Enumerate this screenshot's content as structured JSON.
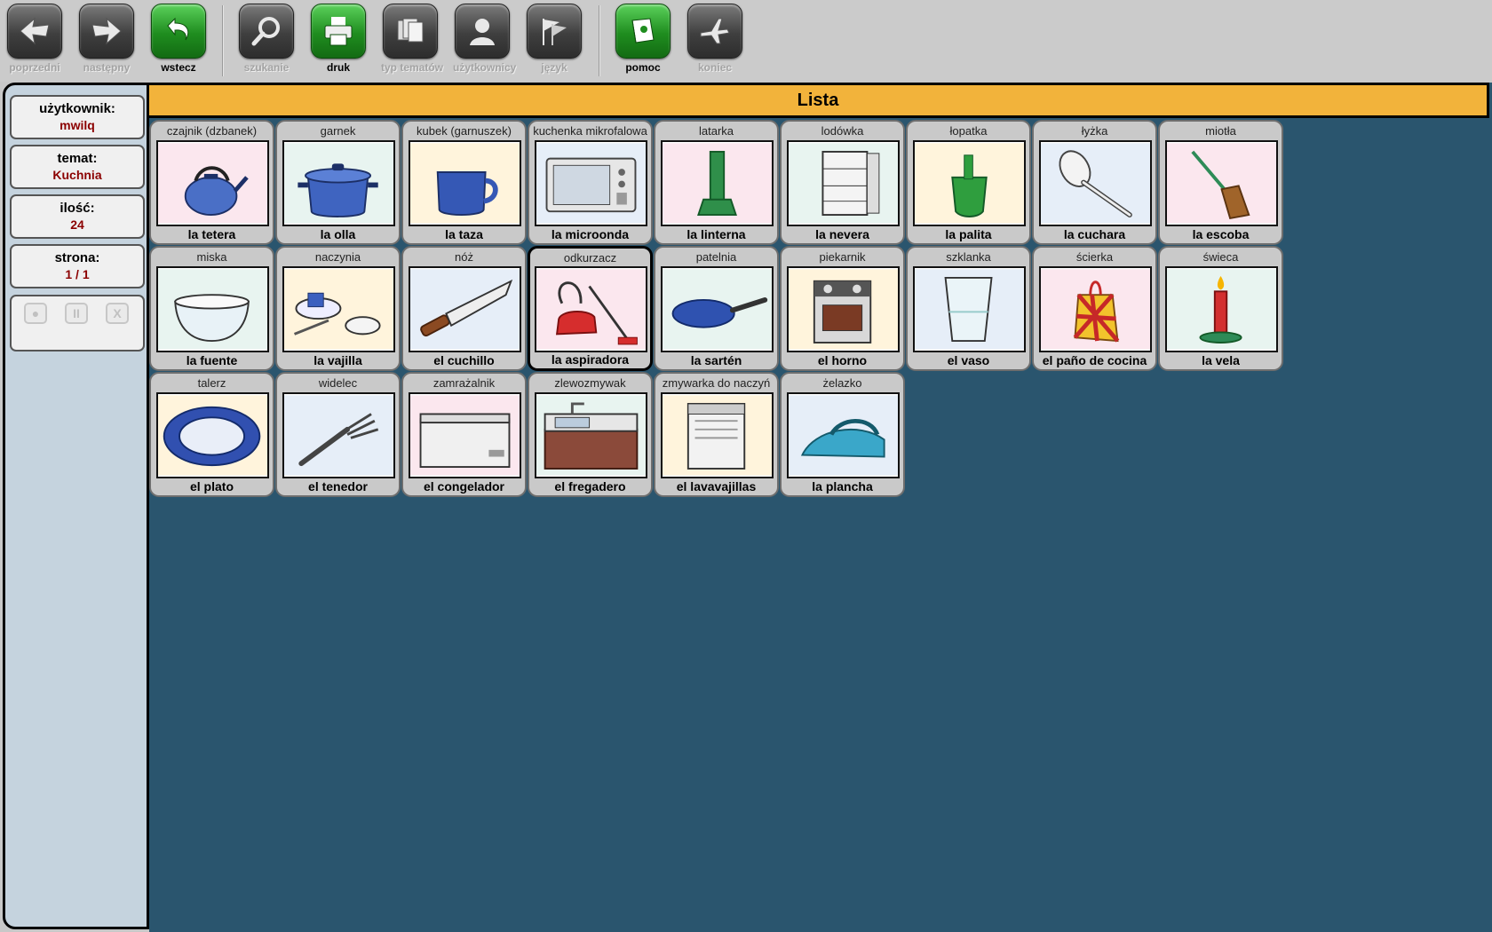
{
  "toolbar": {
    "buttons": [
      {
        "label": "poprzedni",
        "icon": "arrow-left-icon",
        "state": "disabled"
      },
      {
        "label": "następny",
        "icon": "arrow-right-icon",
        "state": "disabled"
      },
      {
        "label": "wstecz",
        "icon": "undo-icon",
        "state": "active"
      },
      {
        "label": "szukanie",
        "icon": "magnifier-icon",
        "state": "disabled"
      },
      {
        "label": "druk",
        "icon": "print-icon",
        "state": "active"
      },
      {
        "label": "typ tematów",
        "icon": "cards-icon",
        "state": "disabled"
      },
      {
        "label": "użytkownicy",
        "icon": "user-icon",
        "state": "disabled"
      },
      {
        "label": "język",
        "icon": "flags-icon",
        "state": "disabled"
      },
      {
        "label": "pomoc",
        "icon": "help-book-icon",
        "state": "active"
      },
      {
        "label": "koniec",
        "icon": "exit-plane-icon",
        "state": "disabled"
      }
    ]
  },
  "sidebar": {
    "user_label": "użytkownik:",
    "user_value": "mwilq",
    "topic_label": "temat:",
    "topic_value": "Kuchnia",
    "count_label": "ilość:",
    "count_value": "24",
    "page_label": "strona:",
    "page_value": "1 / 1",
    "controls": [
      {
        "label": "●",
        "icon": "record-icon"
      },
      {
        "label": "II",
        "icon": "pause-icon"
      },
      {
        "label": "X",
        "icon": "stop-icon"
      }
    ]
  },
  "main": {
    "title": "Lista",
    "cards": [
      {
        "pl": "czajnik (dzbanek)",
        "es": "la tetera",
        "icon": "kettle-icon"
      },
      {
        "pl": "garnek",
        "es": "la olla",
        "icon": "pot-icon"
      },
      {
        "pl": "kubek (garnuszek)",
        "es": "la taza",
        "icon": "mug-icon"
      },
      {
        "pl": "kuchenka mikrofalowa",
        "es": "la microonda",
        "icon": "microwave-icon"
      },
      {
        "pl": "latarka",
        "es": "la linterna",
        "icon": "flashlight-icon"
      },
      {
        "pl": "lodówka",
        "es": "la nevera",
        "icon": "fridge-icon"
      },
      {
        "pl": "łopatka",
        "es": "la palita",
        "icon": "dustpan-icon"
      },
      {
        "pl": "łyżka",
        "es": "la cuchara",
        "icon": "spoon-icon"
      },
      {
        "pl": "miotła",
        "es": "la escoba",
        "icon": "broom-icon"
      },
      {
        "pl": "miska",
        "es": "la fuente",
        "icon": "bowl-icon"
      },
      {
        "pl": "naczynia",
        "es": "la vajilla",
        "icon": "dishes-icon"
      },
      {
        "pl": "nóż",
        "es": "el cuchillo",
        "icon": "knife-icon"
      },
      {
        "pl": "odkurzacz",
        "es": "la aspiradora",
        "icon": "vacuum-icon",
        "selected": true
      },
      {
        "pl": "patelnia",
        "es": "la sartén",
        "icon": "pan-icon"
      },
      {
        "pl": "piekarnik",
        "es": "el horno",
        "icon": "oven-icon"
      },
      {
        "pl": "szklanka",
        "es": "el vaso",
        "icon": "glass-icon"
      },
      {
        "pl": "ścierka",
        "es": "el paño de cocina",
        "icon": "cloth-icon"
      },
      {
        "pl": "świeca",
        "es": "la vela",
        "icon": "candle-icon"
      },
      {
        "pl": "talerz",
        "es": "el plato",
        "icon": "plate-icon"
      },
      {
        "pl": "widelec",
        "es": "el tenedor",
        "icon": "fork-icon"
      },
      {
        "pl": "zamrażalnik",
        "es": "el congelador",
        "icon": "freezer-icon"
      },
      {
        "pl": "zlewozmywak",
        "es": "el fregadero",
        "icon": "sink-icon"
      },
      {
        "pl": "zmywarka do naczyń",
        "es": "el lavavajillas",
        "icon": "dishwasher-icon"
      },
      {
        "pl": "żelazko",
        "es": "la plancha",
        "icon": "iron-icon"
      }
    ]
  }
}
